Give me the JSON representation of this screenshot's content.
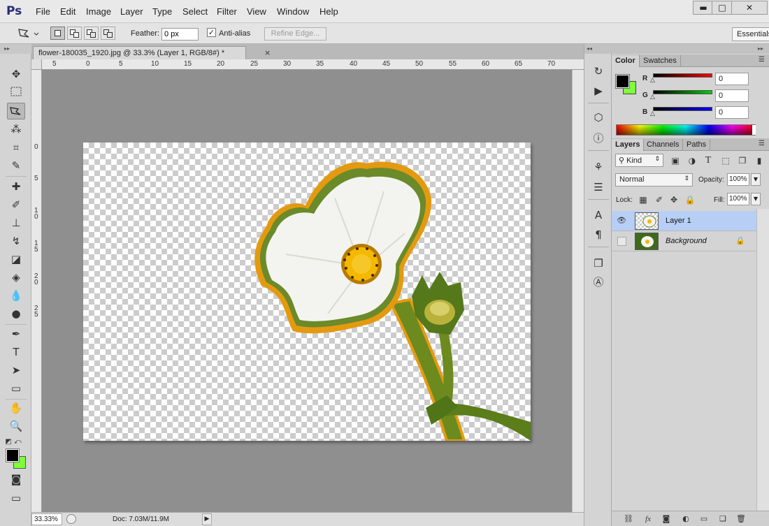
{
  "app": {
    "logo": "Ps"
  },
  "menu": [
    "File",
    "Edit",
    "Image",
    "Layer",
    "Type",
    "Select",
    "Filter",
    "View",
    "Window",
    "Help"
  ],
  "window_controls": {
    "minimize": "▬",
    "maximize": "□",
    "close": "✕"
  },
  "options": {
    "feather_label": "Feather:",
    "feather_value": "0 px",
    "antialias_label": "Anti-alias",
    "antialias_checked": "✓",
    "refine_edge": "Refine Edge...",
    "workspace": "Essentials"
  },
  "document": {
    "tab_title": "flower-180035_1920.jpg @ 33.3% (Layer 1, RGB/8#) *",
    "tab_close": "×",
    "ruler_h": [
      "5",
      "0",
      "5",
      "10",
      "15",
      "20",
      "25",
      "30",
      "35",
      "40",
      "45",
      "50",
      "55",
      "60",
      "65",
      "70"
    ],
    "ruler_v": [
      "0",
      "5",
      "1",
      "0",
      "1",
      "5",
      "2",
      "0",
      "2",
      "5"
    ],
    "zoom": "33.33%",
    "doc_size": "Doc: 7.03M/11.9M",
    "status_arrow": "▶"
  },
  "panels": {
    "color_tabs": [
      "Color",
      "Swatches"
    ],
    "sliders": [
      {
        "label": "R",
        "value": "0",
        "color": "#ff0000"
      },
      {
        "label": "G",
        "value": "0",
        "color": "#00cc00"
      },
      {
        "label": "B",
        "value": "0",
        "color": "#0000ff"
      }
    ],
    "layers_tabs": [
      "Layers",
      "Channels",
      "Paths"
    ],
    "kind": "Kind",
    "blend_mode": "Normal",
    "opacity_label": "Opacity:",
    "opacity_value": "100%",
    "lock_label": "Lock:",
    "fill_label": "Fill:",
    "fill_value": "100%",
    "layers": [
      {
        "name": "Layer 1",
        "visible": true,
        "selected": true
      },
      {
        "name": "Background",
        "visible": false,
        "selected": false,
        "locked": true
      }
    ],
    "bottom_icons": [
      "⛓",
      "fx",
      "◙",
      "◐",
      "▭",
      "❑",
      "🗑"
    ]
  },
  "colors": {
    "foreground": "#000000",
    "background": "#7fff3a",
    "selection": "#b8cff5"
  }
}
